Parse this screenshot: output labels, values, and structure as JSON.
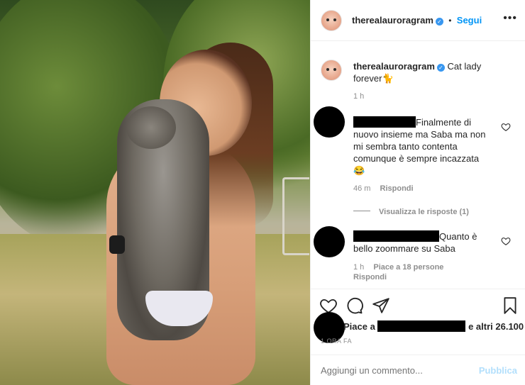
{
  "post": {
    "username": "therealauroragram",
    "follow_label": "Segui",
    "more_label": "•••"
  },
  "caption": {
    "username": "therealauroragram",
    "text": "Cat lady forever",
    "emoji": "🐈",
    "time": "1 h"
  },
  "comments": [
    {
      "text": "Finalmente di nuovo insieme ma Saba ma non mi sembra tanto contenta comunque è sempre incazzata",
      "emoji": "😂",
      "time": "46 m",
      "reply_label": "Rispondi",
      "view_replies_label": "Visualizza le risposte (1)"
    },
    {
      "text": "Quanto è bello zoommare su Saba",
      "time": "1 h",
      "likes_label": "Piace a 18 persone",
      "reply_label": "Rispondi"
    }
  ],
  "likes": {
    "prefix": "Piace a",
    "suffix": "e altri 26.100"
  },
  "date": "1 ORA FA",
  "add_comment": {
    "placeholder": "Aggiungi un commento...",
    "publish_label": "Pubblica"
  },
  "colors": {
    "link_blue": "#0095f6",
    "verified_blue": "#3897f0",
    "publish_disabled": "#b2dffc",
    "meta_gray": "#8e8e8e"
  },
  "icons": [
    "heart-icon",
    "comment-icon",
    "share-icon",
    "bookmark-icon",
    "verified-badge-icon",
    "more-options-icon"
  ]
}
